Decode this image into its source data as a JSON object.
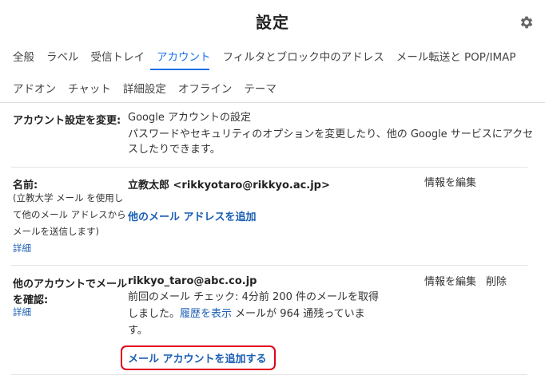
{
  "header": {
    "title": "設定"
  },
  "tabs_row1": [
    "全般",
    "ラベル",
    "受信トレイ",
    "アカウント",
    "フィルタとブロック中のアドレス",
    "メール転送と POP/IMAP"
  ],
  "tabs_row2": [
    "アドオン",
    "チャット",
    "詳細設定",
    "オフライン",
    "テーマ"
  ],
  "active_tab": "アカウント",
  "section_change": {
    "label": "アカウント設定を変更:",
    "link": "Google アカウントの設定",
    "desc_line1": "パスワードやセキュリティのオプションを変更したり、他の Google サービスにアクセ",
    "desc_line2": "スしたりできます。"
  },
  "section_name": {
    "label": "名前:",
    "note_line1": "(立教大学 メール を使用し",
    "note_line2": "て他のメール アドレスから",
    "note_line3": "メールを送信します)",
    "details": "詳細",
    "value": "立教太郎 <rikkyotaro@rikkyo.ac.jp>",
    "add_address": "他のメール アドレスを追加",
    "edit": "情報を編集"
  },
  "section_check": {
    "label_line1": "他のアカウントでメール",
    "label_line2": "を確認:",
    "details": "詳細",
    "account": "rikkyo_taro@abc.co.jp",
    "edit": "情報を編集",
    "delete": "削除",
    "status_line1": "前回のメール チェック: 4分前 200 件のメールを取得",
    "status_line2_pre": "しました。",
    "history_link": "履歴を表示",
    "status_line2_post": " メールが 964 通残っていま",
    "status_line3": "す。",
    "add_account": "メール アカウントを追加する"
  }
}
